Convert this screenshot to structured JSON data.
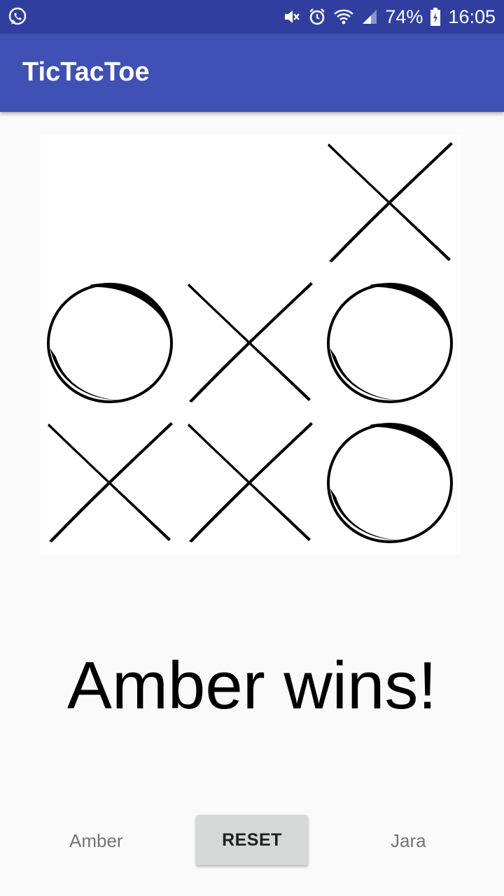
{
  "status_bar": {
    "battery": "74%",
    "time": "16:05",
    "icons": [
      "whatsapp-icon",
      "mute-icon",
      "alarm-icon",
      "wifi-icon",
      "signal-icon",
      "battery-icon"
    ]
  },
  "app_bar": {
    "title": "TicTacToe",
    "color": "#3f51b5",
    "status_color": "#303f9f"
  },
  "board": {
    "cells": [
      "",
      "",
      "X",
      "O",
      "X",
      "O",
      "X",
      "X",
      "O"
    ]
  },
  "result": {
    "text": "Amber wins!"
  },
  "footer": {
    "player1": "Amber",
    "reset_label": "RESET",
    "player2": "Jara"
  }
}
